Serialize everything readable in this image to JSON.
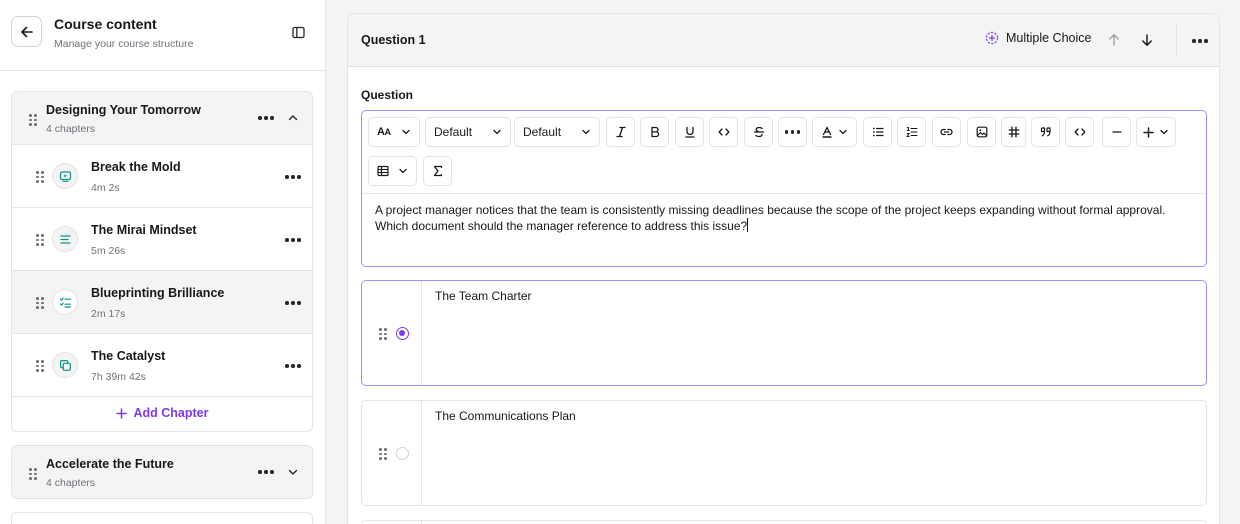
{
  "sidebar": {
    "title": "Course content",
    "subtitle": "Manage your course structure",
    "groups": [
      {
        "title": "Designing Your Tomorrow",
        "subtitle": "4 chapters",
        "expanded": true,
        "lessons": [
          {
            "title": "Break the Mold",
            "duration": "4m 2s",
            "icon": "video-icon"
          },
          {
            "title": "The Mirai Mindset",
            "duration": "5m 26s",
            "icon": "text-icon"
          },
          {
            "title": "Blueprinting Brilliance",
            "duration": "2m 17s",
            "icon": "checklist-icon"
          },
          {
            "title": "The Catalyst",
            "duration": "7h 39m 42s",
            "icon": "copy-icon"
          }
        ],
        "add_label": "Add Chapter"
      },
      {
        "title": "Accelerate the Future",
        "subtitle": "4 chapters",
        "expanded": false
      }
    ]
  },
  "main": {
    "question_title": "Question 1",
    "question_type": "Multiple Choice",
    "field_label": "Question",
    "toolbar": {
      "font_family": "Default",
      "font_size": "Default"
    },
    "question_text": "A project manager notices that the team is consistently missing deadlines because the scope of the project keeps expanding without formal approval. Which document should the manager reference to address this issue?",
    "options": [
      {
        "text": "The Team Charter",
        "selected": true
      },
      {
        "text": "The Communications Plan",
        "selected": false
      }
    ]
  },
  "colors": {
    "accent": "#7c3aed",
    "accent_border": "#a78bfa",
    "border": "#e4e4e7",
    "muted": "#71717a"
  }
}
